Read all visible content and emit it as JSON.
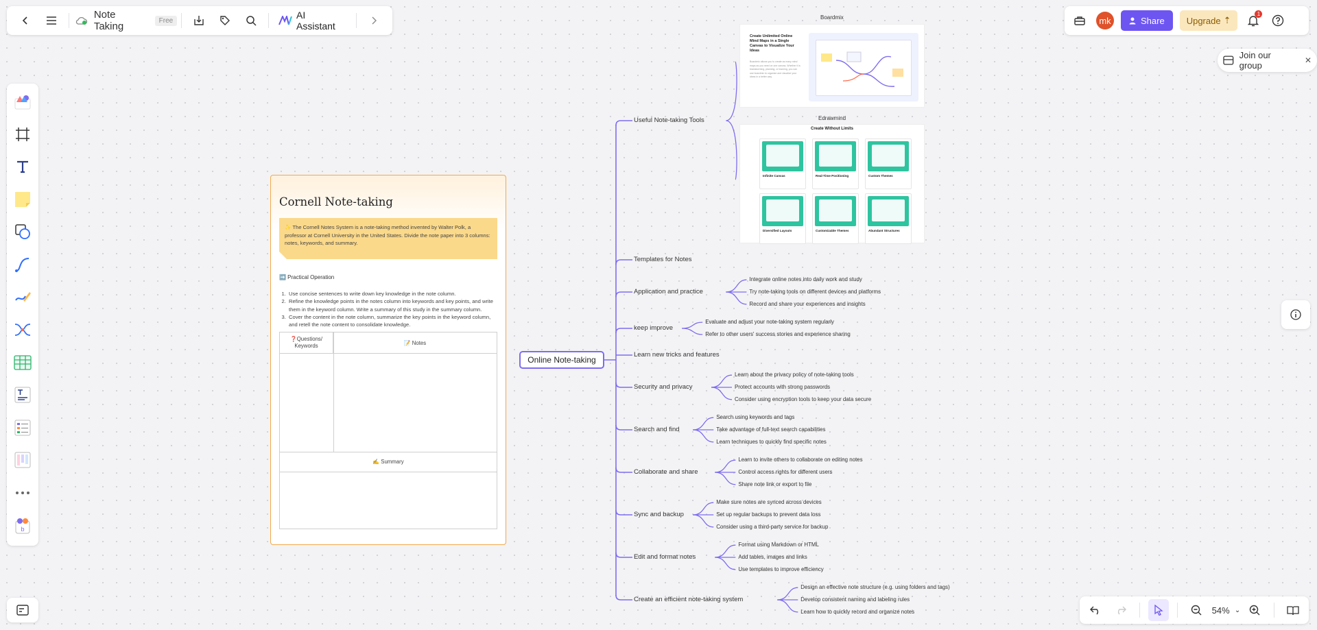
{
  "app": {
    "doc_title": "Note Taking",
    "plan_badge": "Free",
    "ai_label": "AI Assistant"
  },
  "top_right": {
    "avatar_initials": "mk",
    "share_label": "Share",
    "upgrade_label": "Upgrade",
    "notification_count": "1"
  },
  "join_group": {
    "label": "Join our group"
  },
  "zoom": {
    "level": "54%"
  },
  "left_tools": [
    "templates-icon",
    "frame-icon",
    "text-icon",
    "sticky-note-icon",
    "shape-icon",
    "connector-icon",
    "pen-icon",
    "mindmap-icon",
    "table-icon",
    "text-block-icon",
    "list-icon",
    "kanban-icon",
    "more-icon",
    "plugin-icon"
  ],
  "cornell": {
    "title": "Cornell Note-taking",
    "intro_icon": "✨",
    "intro": "The Cornell Notes System is a note-taking method invented by Walter Polk, a professor at Cornell University in the United States. Divide the note paper into 3 columns: notes, keywords, and summary.",
    "practical_label": "➡️ Practical Operation",
    "steps": [
      "Use concise sentences to write down key knowledge in the note column.",
      "Refine the knowledge points in the notes column into keywords and key points, and write them in the keyword column. Write a summary of this study in the summary column.",
      "Cover the content in the note column, summarize the key points in the keyword column, and retell the note content to consolidate knowledge."
    ],
    "questions_header": "❓Questions/ Keywords",
    "notes_header": "📝 Notes",
    "summary_header": "✍️ Summary"
  },
  "mindmap": {
    "root": "Online Note-taking",
    "branches": [
      {
        "label": "Useful Note-taking Tools",
        "children": []
      },
      {
        "label": "Templates for Notes",
        "children": []
      },
      {
        "label": "Application and practice",
        "children": [
          "Integrate online notes into daily work and study",
          "Try note-taking tools on different devices and platforms",
          "Record and share your experiences and insights"
        ]
      },
      {
        "label": "keep improve",
        "children": [
          "Evaluate and adjust your note-taking system regularly",
          "Refer to other users' success stories and experience sharing"
        ]
      },
      {
        "label": "Learn new tricks and features",
        "children": []
      },
      {
        "label": "Security and privacy",
        "children": [
          "Learn about the privacy policy of note-taking tools",
          "Protect accounts with strong passwords",
          "Consider using encryption tools to keep your data secure"
        ]
      },
      {
        "label": "Search and find",
        "children": [
          "Search using keywords and tags",
          "Take advantage of full-text search capabilities",
          "Learn techniques to quickly find specific notes"
        ]
      },
      {
        "label": "Collaborate and share",
        "children": [
          "Learn to invite others to collaborate on editing notes",
          "Control access rights for different users",
          "Share note link or export to file"
        ]
      },
      {
        "label": "Sync and backup",
        "children": [
          "Make sure notes are synced across devices",
          "Set up regular backups to prevent data loss",
          "Consider using a third-party service for backup"
        ]
      },
      {
        "label": "Edit and format notes",
        "children": [
          "Format using Markdown or HTML",
          "Add tables, images and links",
          "Use templates to improve efficiency"
        ]
      },
      {
        "label": "Create an efficient note-taking system",
        "children": [
          "Design an effective note structure (e.g. using folders and tags)",
          "Develop consistent naming and labeling rules",
          "Learn how to quickly record and organize notes"
        ]
      }
    ]
  },
  "tool_cards": {
    "boardmix": {
      "label": "Boardmix",
      "headline": "Create Unlimited Online Mind Maps in a Single Canvas to Visualize Your Ideas",
      "body": "Boardmix allows you to create as many mind maps as you need on one canvas. Whether it is brainstorming, planning, or learning, you can use boardmix to organize and visualize your ideas in a better way."
    },
    "edrawmind": {
      "label": "Edrawmind",
      "headline": "Create Without Limits",
      "tiles": [
        "Infinite Canvas",
        "Real-Time Positioning",
        "Custom Themes",
        "Diversified Layouts",
        "Customizable Themes",
        "Abundant Structures"
      ]
    }
  },
  "colors": {
    "accent": "#6d55f2",
    "mindmap_line": "#7d6cf0",
    "cornell_border": "#f3a94a",
    "intro_bg": "#fbd98a",
    "tile_green": "#2ec4a0"
  }
}
